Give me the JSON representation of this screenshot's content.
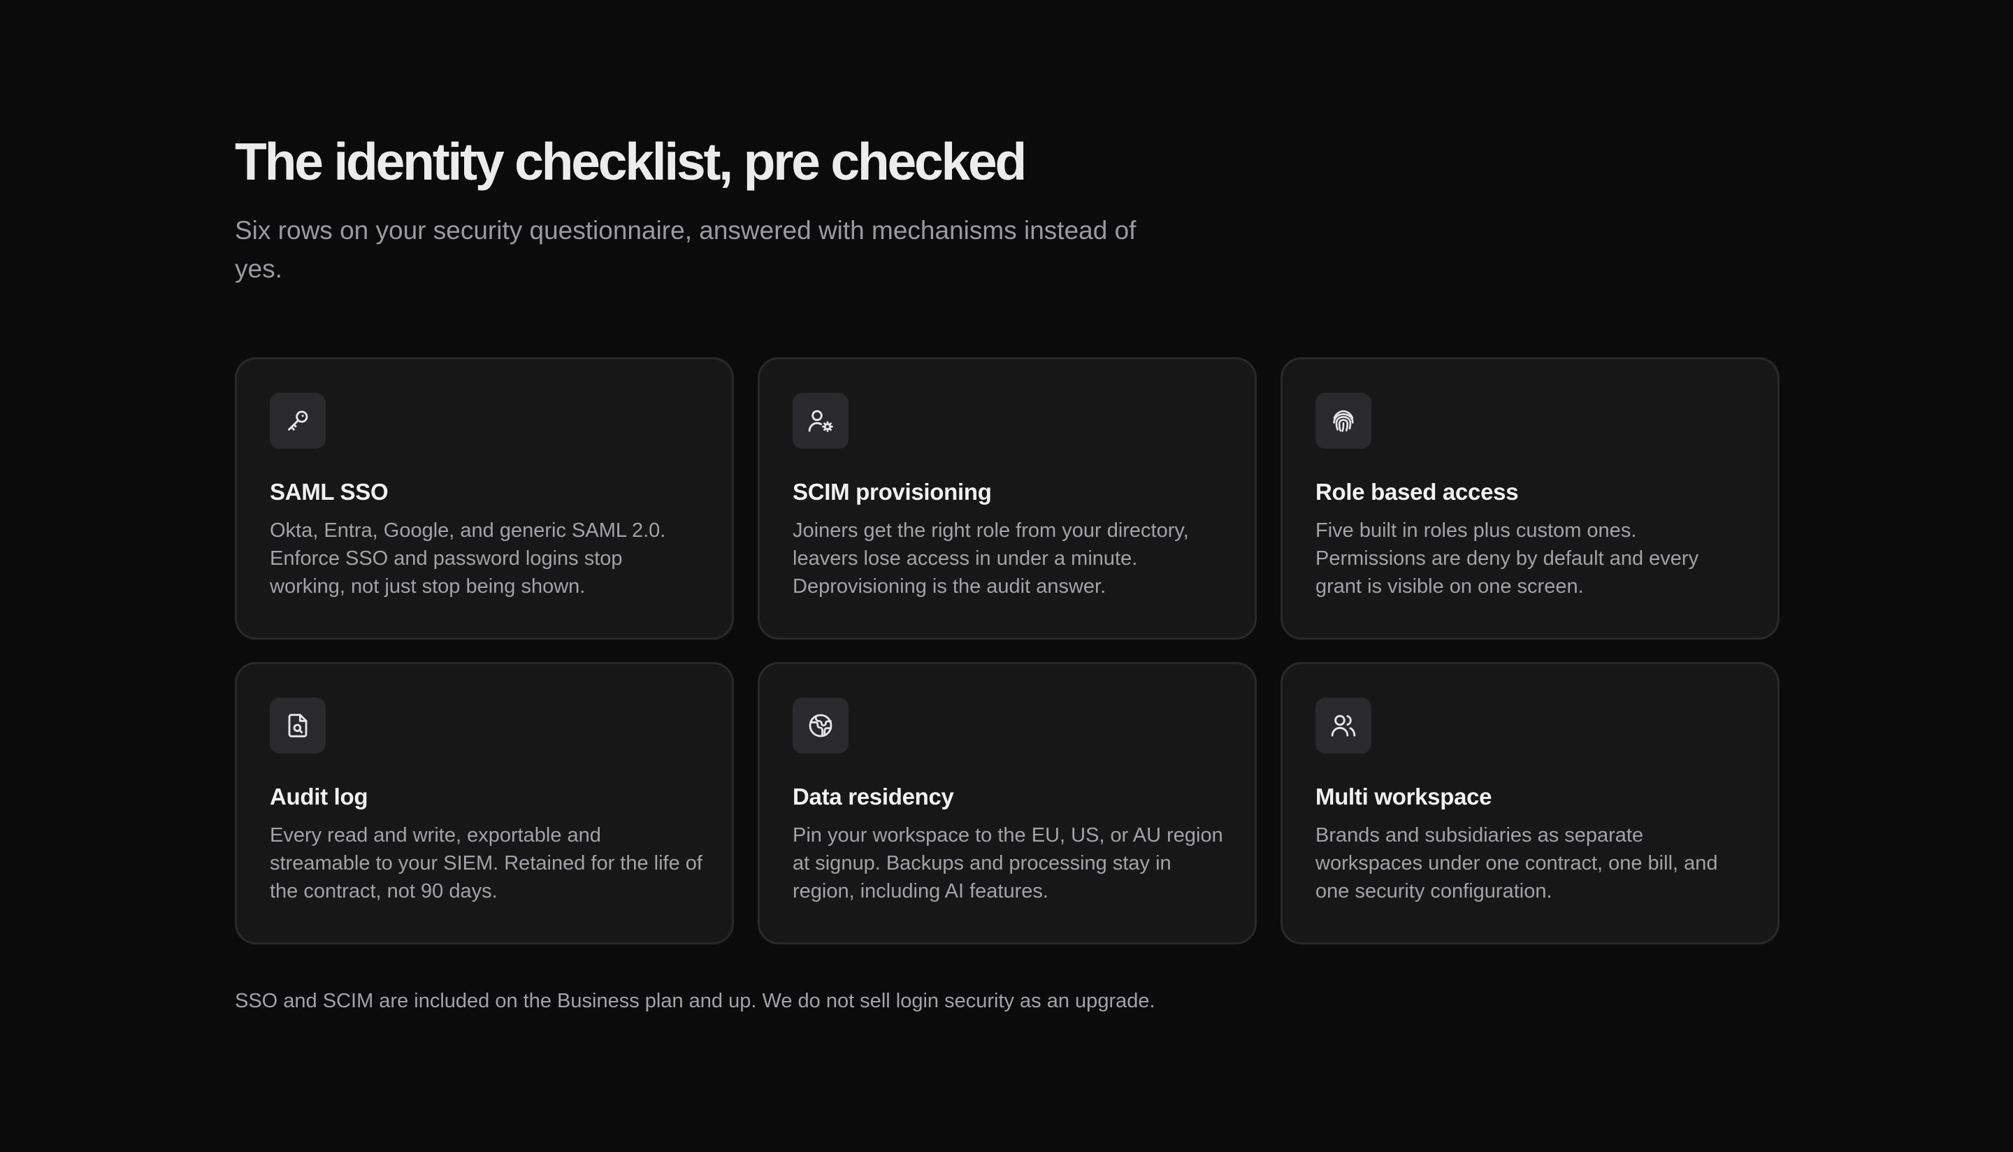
{
  "header": {
    "title": "The identity checklist, pre checked",
    "subtitle": "Six rows on your security questionnaire, answered with mechanisms instead of yes."
  },
  "cards": [
    {
      "icon": "key-icon",
      "title": "SAML SSO",
      "description": "Okta, Entra, Google, and generic SAML 2.0. Enforce SSO and password logins stop working, not just stop being shown."
    },
    {
      "icon": "user-cog-icon",
      "title": "SCIM provisioning",
      "description": "Joiners get the right role from your directory, leavers lose access in under a minute. Deprovisioning is the audit answer."
    },
    {
      "icon": "fingerprint-icon",
      "title": "Role based access",
      "description": "Five built in roles plus custom ones. Permissions are deny by default and every grant is visible on one screen."
    },
    {
      "icon": "file-search-icon",
      "title": "Audit log",
      "description": "Every read and write, exportable and streamable to your SIEM. Retained for the life of the contract, not 90 days."
    },
    {
      "icon": "globe-icon",
      "title": "Data residency",
      "description": "Pin your workspace to the EU, US, or AU region at signup. Backups and processing stay in region, including AI features."
    },
    {
      "icon": "users-icon",
      "title": "Multi workspace",
      "description": "Brands and subsidiaries as separate workspaces under one contract, one bill, and one security configuration."
    }
  ],
  "footnote": "SSO and SCIM are included on the Business plan and up. We do not sell login security as an upgrade.",
  "colors": {
    "background": "#0b0b0c",
    "card": "#171718",
    "card_border": "#29292c",
    "icon_tile": "#2a2a2d",
    "heading": "#ececed",
    "muted": "#a2a2a7"
  }
}
